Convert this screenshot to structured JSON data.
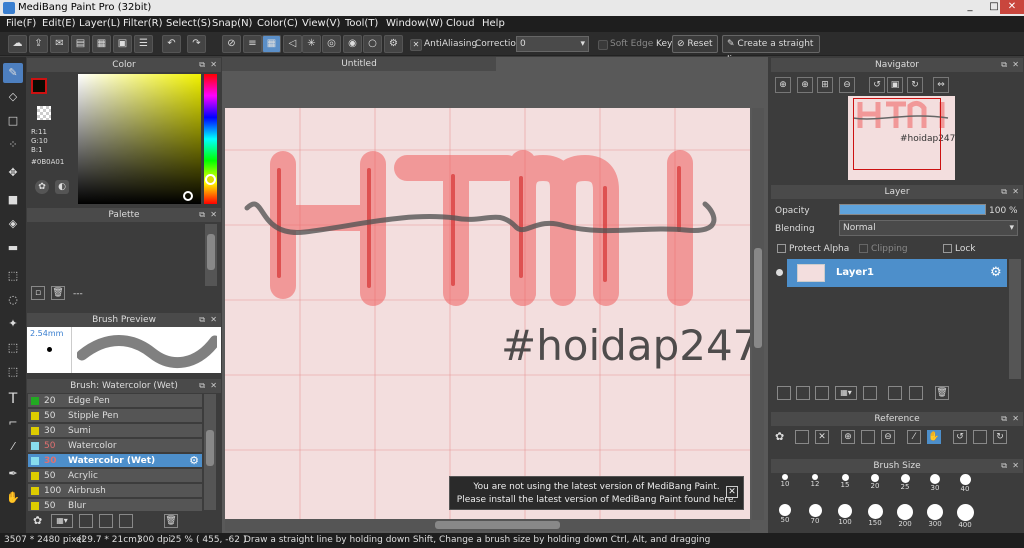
{
  "title": "MediBang Paint Pro (32bit)",
  "window_controls": [
    "_",
    "□",
    "✕"
  ],
  "menu": [
    "File(F)",
    "Edit(E)",
    "Layer(L)",
    "Filter(R)",
    "Select(S)",
    "Snap(N)",
    "Color(C)",
    "View(V)",
    "Tool(T)",
    "Window(W)",
    "Cloud",
    "Help"
  ],
  "toolbar": {
    "antialiasing_label": "AntiAliasing",
    "correction_label": "Correction",
    "correction_value": "0",
    "soft_edge_label": "Soft Edge",
    "key_label": "Key",
    "reset_label": "Reset",
    "straight_line_label": "Create a straight line"
  },
  "color_panel": {
    "title": "Color",
    "r": "R:11",
    "g": "G:10",
    "b": "B:1",
    "hex": "#0B0A01",
    "fg_color": "#0B0A01",
    "swatch_border": "#cc1111"
  },
  "palette_panel": {
    "title": "Palette",
    "value": "---"
  },
  "brush_preview": {
    "title": "Brush Preview",
    "size": "2.54mm"
  },
  "brush_panel": {
    "title": "Brush: Watercolor (Wet)",
    "items": [
      {
        "num": "20",
        "name": "Edge Pen",
        "color": "#22aa22"
      },
      {
        "num": "50",
        "name": "Stipple Pen",
        "color": "#ddcc00"
      },
      {
        "num": "30",
        "name": "Sumi",
        "color": "#ddcc00"
      },
      {
        "num": "50",
        "name": "Watercolor",
        "color": "#88ddee"
      },
      {
        "num": "30",
        "name": "Watercolor (Wet)",
        "color": "#88ddee"
      },
      {
        "num": "50",
        "name": "Acrylic",
        "color": "#ddcc00"
      },
      {
        "num": "100",
        "name": "Airbrush",
        "color": "#ddcc00"
      },
      {
        "num": "50",
        "name": "Blur",
        "color": "#ddcc00"
      }
    ]
  },
  "document": {
    "tab": "Untitled",
    "canvas_text": "#hoidap247"
  },
  "notice": {
    "line1": "You are not using the latest version of MediBang Paint.",
    "line2": "Please install the latest version of MediBang Paint found here."
  },
  "navigator": {
    "title": "Navigator"
  },
  "layer_panel": {
    "title": "Layer",
    "opacity_label": "Opacity",
    "opacity_value": "100 %",
    "opacity": 1.0,
    "blending_label": "Blending",
    "blending_value": "Normal",
    "protect_alpha": "Protect Alpha",
    "clipping": "Clipping",
    "lock": "Lock",
    "layer_name": "Layer1"
  },
  "reference": {
    "title": "Reference"
  },
  "brush_size": {
    "title": "Brush Size",
    "row1": [
      "10",
      "12",
      "15",
      "20",
      "25",
      "30",
      "40"
    ],
    "row2": [
      "50",
      "70",
      "100",
      "150",
      "200",
      "300",
      "400"
    ]
  },
  "status": {
    "dimensions": "3507 * 2480 pixel",
    "cm": "(29.7 * 21cm)",
    "dpi": "300 dpi",
    "zoom": "25 %",
    "coords": "( 455, -62 )",
    "hint": "Draw a straight line by holding down Shift, Change a brush size by holding down Ctrl, Alt, and dragging"
  }
}
